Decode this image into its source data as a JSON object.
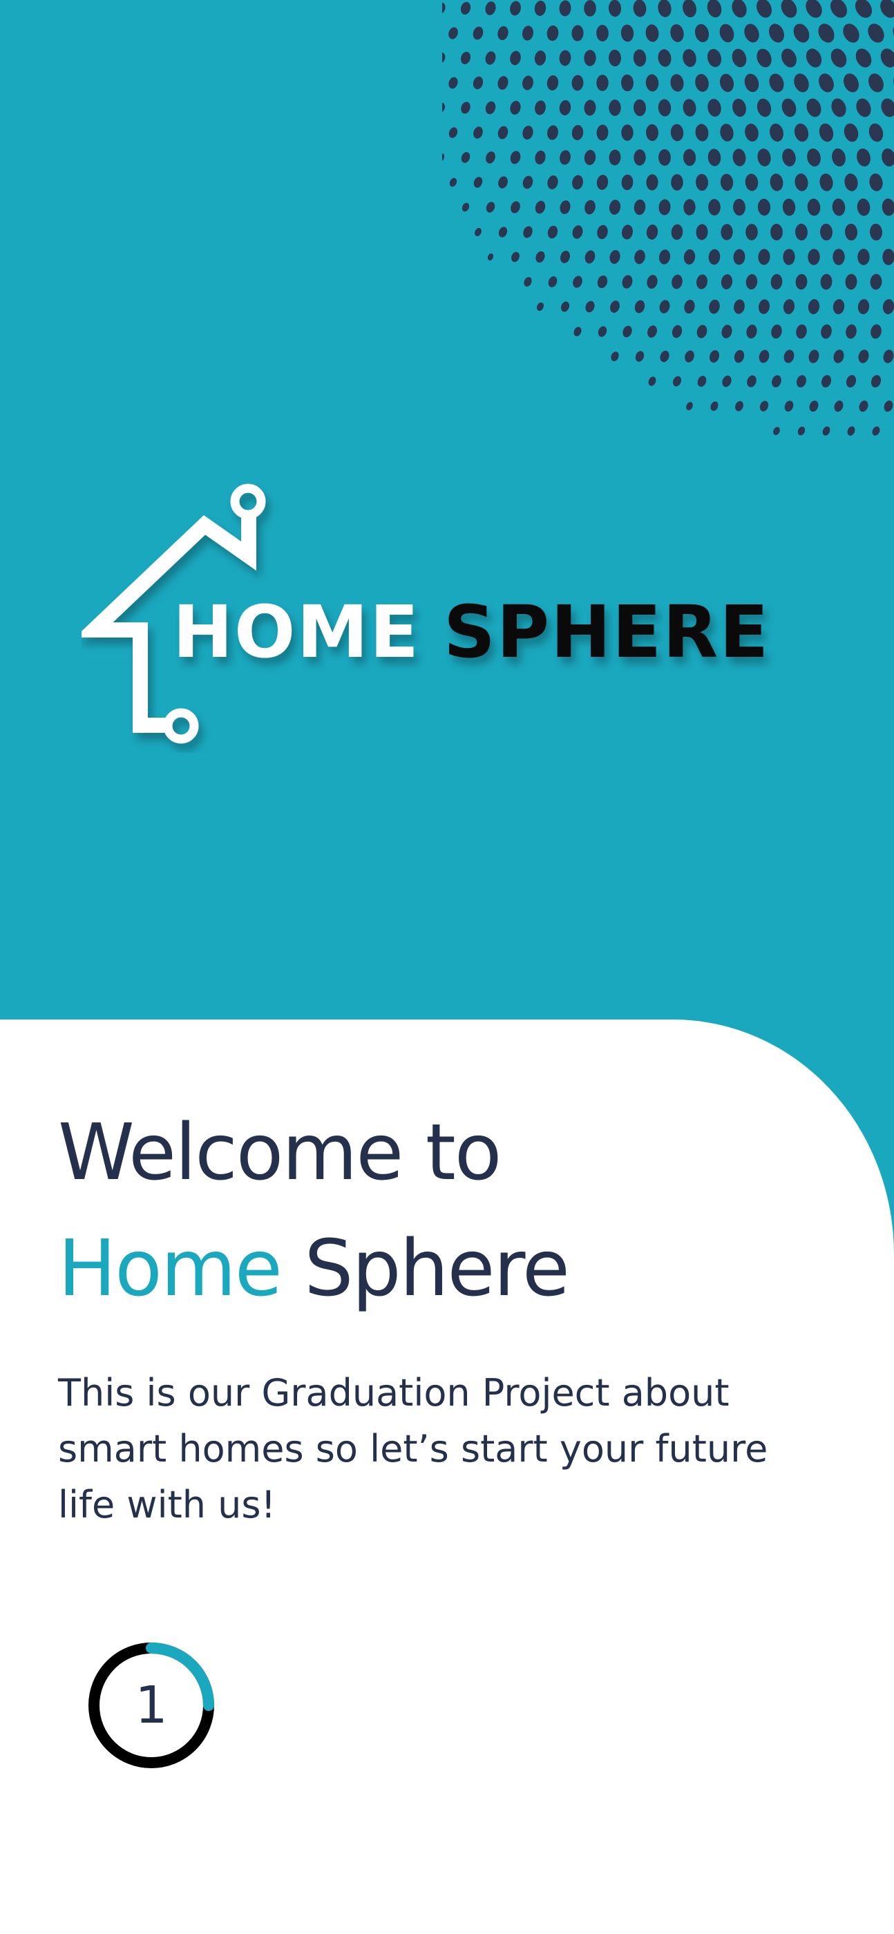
{
  "brand": {
    "logo_word_1": "HOME",
    "logo_word_2": "SPHERE",
    "primary_color": "#1aa8bf",
    "dark_color": "#25304d",
    "logo_icon": "house-circuit-icon"
  },
  "welcome": {
    "title_line_1": "Welcome to",
    "title_accent": "Home",
    "title_rest": "Sphere",
    "description": "This is our Graduation Project about smart homes so let’s start your future life with us!"
  },
  "onboarding": {
    "step": "1",
    "progress_fraction": 0.25
  }
}
